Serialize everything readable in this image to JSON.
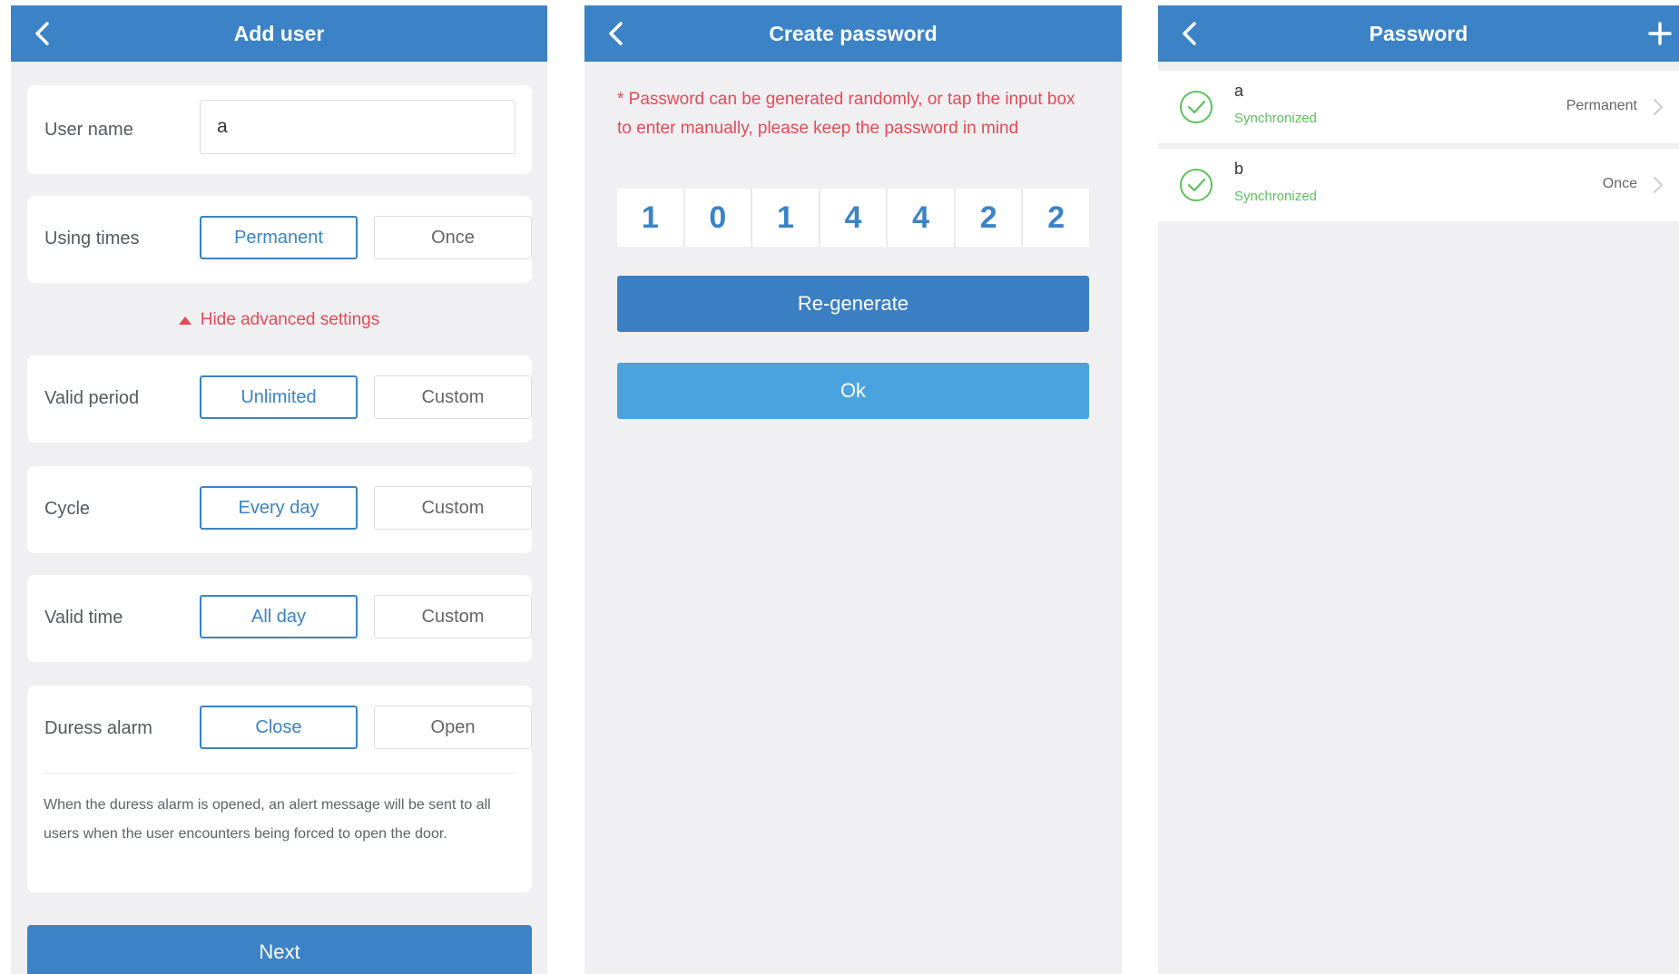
{
  "add_user": {
    "title": "Add user",
    "user_name": {
      "label": "User name",
      "value": "a"
    },
    "using_times": {
      "label": "Using times",
      "selected": "Permanent",
      "other": "Once"
    },
    "advanced_toggle": "Hide advanced settings",
    "valid_period": {
      "label": "Valid period",
      "selected": "Unlimited",
      "other": "Custom"
    },
    "cycle": {
      "label": "Cycle",
      "selected": "Every day",
      "other": "Custom"
    },
    "valid_time": {
      "label": "Valid time",
      "selected": "All day",
      "other": "Custom"
    },
    "duress_alarm": {
      "label": "Duress alarm",
      "selected": "Close",
      "other": "Open"
    },
    "duress_note": "When the duress alarm is opened, an alert message will be sent to all users when the user encounters being forced to open the door.",
    "next": "Next"
  },
  "create_password": {
    "title": "Create password",
    "hint": "* Password can be generated randomly, or tap the input box to enter manually, please keep the password in mind",
    "digits": [
      "1",
      "0",
      "1",
      "4",
      "4",
      "2",
      "2"
    ],
    "regenerate": "Re-generate",
    "ok": "Ok"
  },
  "password_list": {
    "title": "Password",
    "items": [
      {
        "name": "a",
        "status": "Synchronized",
        "type": "Permanent"
      },
      {
        "name": "b",
        "status": "Synchronized",
        "type": "Once"
      }
    ]
  },
  "colors": {
    "header_blue": "#3b83c6",
    "ok_blue": "#4aa3df",
    "accent_red": "#e84a55",
    "sync_green": "#5cc15c",
    "background": "#f0f0f3"
  },
  "icons": {
    "back": "chevron-left-icon",
    "add": "plus-icon",
    "synced": "check-circle-icon",
    "row_arrow": "chevron-right-icon",
    "advanced": "triangle-up-icon"
  }
}
